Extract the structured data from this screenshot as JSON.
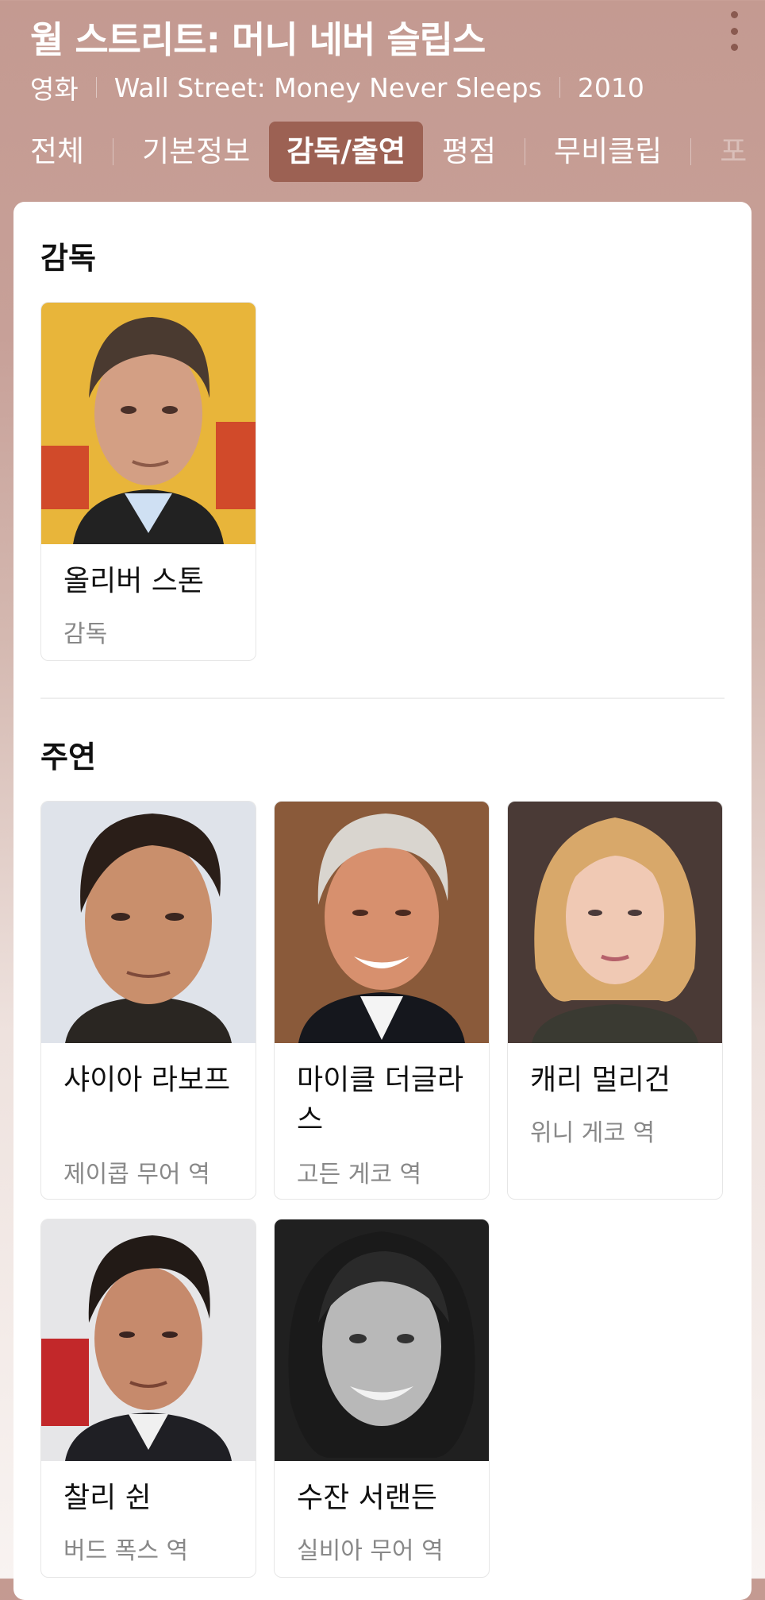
{
  "header": {
    "title": "월 스트리트: 머니 네버 슬립스",
    "meta_type": "영화",
    "meta_original_title": "Wall Street: Money Never Sleeps",
    "meta_year": "2010",
    "more_icon": "more-vertical-icon"
  },
  "tabs": [
    {
      "label": "전체"
    },
    {
      "label": "기본정보"
    },
    {
      "label": "감독/출연",
      "active": true
    },
    {
      "label": "평점"
    },
    {
      "label": "무비클립"
    },
    {
      "label": "포"
    }
  ],
  "director_section": {
    "title": "감독",
    "people": [
      {
        "name": "올리버 스톤",
        "role": "감독"
      }
    ]
  },
  "cast_section": {
    "title": "주연",
    "people": [
      {
        "name": "샤이아 라보프",
        "role": "제이콥 무어 역"
      },
      {
        "name": "마이클 더글라스",
        "role": "고든 게코 역"
      },
      {
        "name": "캐리 멀리건",
        "role": "위니 게코 역"
      },
      {
        "name": "찰리 쉰",
        "role": "버드 폭스 역"
      },
      {
        "name": "수잔 서랜든",
        "role": "실비아 무어 역"
      }
    ]
  }
}
